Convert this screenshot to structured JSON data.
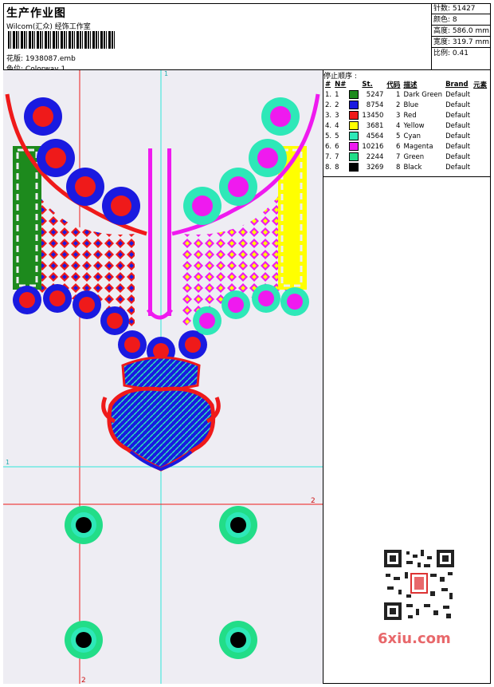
{
  "header": {
    "title": "生产作业图",
    "company": "Wilcom(汇众) 经饰工作室",
    "file_label": "花版:",
    "file_name": "1938087.emb",
    "colorway_label": "色位:",
    "colorway_name": "Colorway 1"
  },
  "stats": {
    "stitches": "针数: 51427",
    "colors": "颜色: 8",
    "height": "高度: 586.0 mm",
    "width": "宽度: 319.7 mm",
    "scale": "比例: 0.41"
  },
  "legend": {
    "title": "停止顺序 :",
    "headers": [
      "#",
      "N#",
      "St.",
      "代码",
      "描述",
      "Brand",
      "元素"
    ],
    "rows": [
      {
        "num": "1.",
        "n": "1",
        "color": "#1d8a1d",
        "st": "5247",
        "code": "1",
        "desc": "Dark Green",
        "brand": "Default"
      },
      {
        "num": "2.",
        "n": "2",
        "color": "#1a1ae0",
        "st": "8754",
        "code": "2",
        "desc": "Blue",
        "brand": "Default"
      },
      {
        "num": "3.",
        "n": "3",
        "color": "#ef1a1a",
        "st": "13450",
        "code": "3",
        "desc": "Red",
        "brand": "Default"
      },
      {
        "num": "4.",
        "n": "4",
        "color": "#ffff00",
        "st": "3681",
        "code": "4",
        "desc": "Yellow",
        "brand": "Default"
      },
      {
        "num": "5.",
        "n": "5",
        "color": "#2ee8b8",
        "st": "4564",
        "code": "5",
        "desc": "Cyan",
        "brand": "Default"
      },
      {
        "num": "6.",
        "n": "6",
        "color": "#ef1aef",
        "st": "10216",
        "code": "6",
        "desc": "Magenta",
        "brand": "Default"
      },
      {
        "num": "7.",
        "n": "7",
        "color": "#22dd88",
        "st": "2244",
        "code": "7",
        "desc": "Green",
        "brand": "Default"
      },
      {
        "num": "8.",
        "n": "8",
        "color": "#000000",
        "st": "3269",
        "code": "8",
        "desc": "Black",
        "brand": "Default"
      }
    ]
  },
  "guides": {
    "v1": "1",
    "h1": "1",
    "v2": "2",
    "h2": "2"
  },
  "watermark": "6xiu.com"
}
